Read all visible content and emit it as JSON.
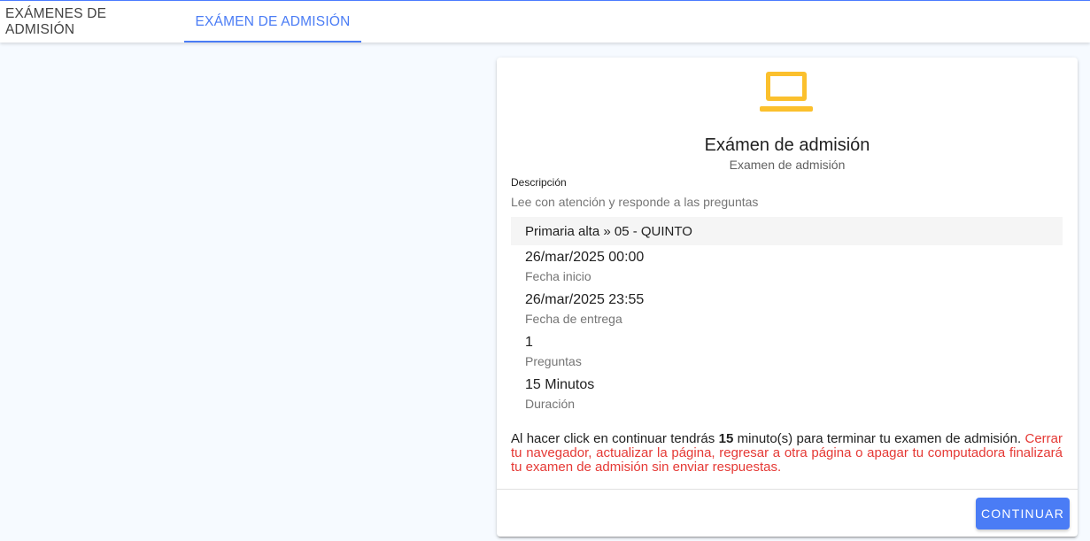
{
  "tabs": [
    {
      "label": "EXÁMENES DE ADMISIÓN",
      "active": false
    },
    {
      "label": "EXÁMEN DE ADMISIÓN",
      "active": true
    }
  ],
  "colors": {
    "accent": "#4a7cf5",
    "icon": "#fbc02d",
    "warning": "#e53935",
    "page_bg": "#f6faff"
  },
  "card": {
    "icon": "laptop-icon",
    "title": "Exámen de admisión",
    "subtitle": "Examen de admisión",
    "description_label": "Descripción",
    "description_text": "Lee con atención y responde a las preguntas",
    "level": "Primaria alta » 05 - QUINTO",
    "info": [
      {
        "value": "26/mar/2025 00:00",
        "label": "Fecha inicio"
      },
      {
        "value": "26/mar/2025 23:55",
        "label": "Fecha de entrega"
      },
      {
        "value": "1",
        "label": "Preguntas"
      },
      {
        "value": "15 Minutos",
        "label": "Duración"
      }
    ],
    "warning": {
      "prefix": "Al hacer click en continuar tendrás ",
      "minutes": "15",
      "suffix": " minuto(s) para terminar tu examen de admisión. ",
      "alert": "Cerrar tu navegador, actualizar la página, regresar a otra página o apagar tu computadora finalizará tu examen de admisión sin enviar respuestas."
    },
    "continue_label": "CONTINUAR"
  }
}
